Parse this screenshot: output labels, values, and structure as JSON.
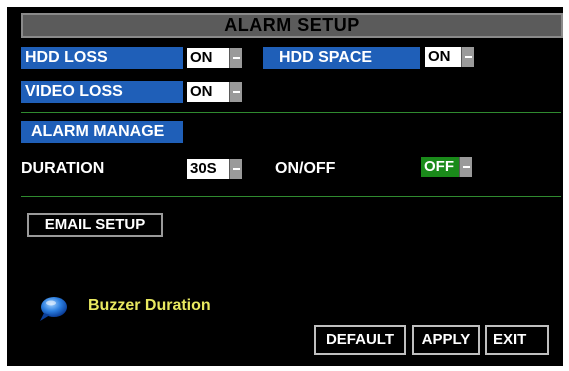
{
  "title": "ALARM SETUP",
  "hdd_loss": {
    "label": "HDD LOSS",
    "value": "ON"
  },
  "hdd_space": {
    "label": "HDD SPACE",
    "value": "ON"
  },
  "video_loss": {
    "label": "VIDEO LOSS",
    "value": "ON"
  },
  "alarm_manage": {
    "label": "ALARM MANAGE"
  },
  "duration": {
    "label": "DURATION",
    "value": "30S"
  },
  "onoff": {
    "label": "ON/OFF",
    "value": "OFF"
  },
  "email_setup": {
    "label": "EMAIL SETUP"
  },
  "help": {
    "icon": "info-bubble-icon",
    "text": "Buzzer Duration"
  },
  "buttons": {
    "default": "DEFAULT",
    "apply": "APPLY",
    "exit": "EXIT"
  },
  "colors": {
    "label_blue": "#1f5fb8",
    "divider_green": "#2f8a2f",
    "toggle_green": "#1a8a1a",
    "help_text_yellow": "#e8e860"
  }
}
